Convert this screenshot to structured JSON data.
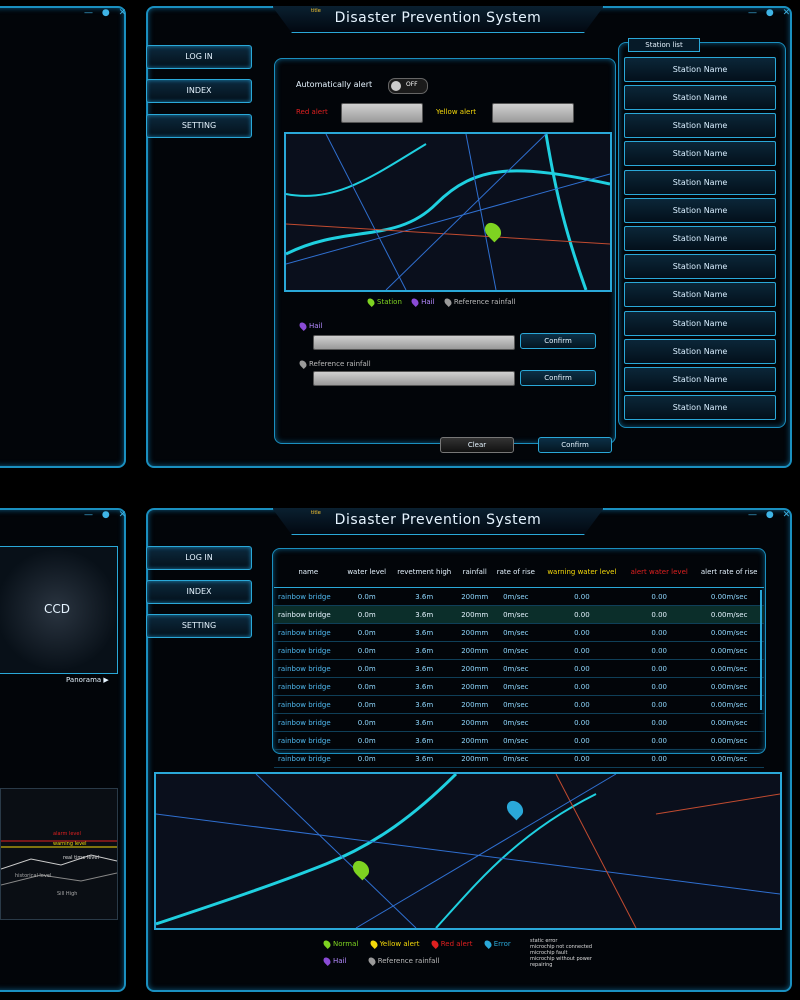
{
  "top": {
    "title_small": "title",
    "title": "Disaster Prevention System",
    "nav": [
      "LOG IN",
      "INDEX",
      "SETTING"
    ],
    "auto_alert": {
      "label": "Automatically alert",
      "toggle": "OFF"
    },
    "red_alert_label": "Red alert",
    "yellow_alert_label": "Yellow alert",
    "red_alert_value": "",
    "yellow_alert_value": "",
    "map_legend": {
      "station": "Station",
      "hail": "Hail",
      "reference": "Reference rainfall"
    },
    "hail_label": "Hail",
    "reference_label": "Reference rainfall",
    "confirm": "Confirm",
    "clear": "Clear",
    "station_list_title": "Station list",
    "stations": [
      "Station Name",
      "Station Name",
      "Station Name",
      "Station Name",
      "Station Name",
      "Station Name",
      "Station Name",
      "Station Name",
      "Station Name",
      "Station Name",
      "Station Name",
      "Station Name",
      "Station Name"
    ]
  },
  "bottom": {
    "title_small": "title",
    "title": "Disaster Prevention System",
    "nav": [
      "LOG IN",
      "INDEX",
      "SETTING"
    ],
    "ccd_label": "CCD",
    "panorama": "Panorama ▶",
    "chart_levels": [
      "alarm level",
      "warning level",
      "real time level",
      "historical level",
      "Sill High"
    ],
    "table": {
      "headers": [
        "name",
        "water level",
        "revetment high",
        "rainfall",
        "rate of rise",
        "warning water level",
        "alert water level",
        "alert rate of rise"
      ],
      "rows": [
        [
          "rainbow bridge",
          "0.0m",
          "3.6m",
          "200mm",
          "0m/sec",
          "0.00",
          "0.00",
          "0.00m/sec"
        ],
        [
          "rainbow bridge",
          "0.0m",
          "3.6m",
          "200mm",
          "0m/sec",
          "0.00",
          "0.00",
          "0.00m/sec"
        ],
        [
          "rainbow bridge",
          "0.0m",
          "3.6m",
          "200mm",
          "0m/sec",
          "0.00",
          "0.00",
          "0.00m/sec"
        ],
        [
          "rainbow bridge",
          "0.0m",
          "3.6m",
          "200mm",
          "0m/sec",
          "0.00",
          "0.00",
          "0.00m/sec"
        ],
        [
          "rainbow bridge",
          "0.0m",
          "3.6m",
          "200mm",
          "0m/sec",
          "0.00",
          "0.00",
          "0.00m/sec"
        ],
        [
          "rainbow bridge",
          "0.0m",
          "3.6m",
          "200mm",
          "0m/sec",
          "0.00",
          "0.00",
          "0.00m/sec"
        ],
        [
          "rainbow bridge",
          "0.0m",
          "3.6m",
          "200mm",
          "0m/sec",
          "0.00",
          "0.00",
          "0.00m/sec"
        ],
        [
          "rainbow bridge",
          "0.0m",
          "3.6m",
          "200mm",
          "0m/sec",
          "0.00",
          "0.00",
          "0.00m/sec"
        ],
        [
          "rainbow bridge",
          "0.0m",
          "3.6m",
          "200mm",
          "0m/sec",
          "0.00",
          "0.00",
          "0.00m/sec"
        ],
        [
          "rainbow bridge",
          "0.0m",
          "3.6m",
          "200mm",
          "0m/sec",
          "0.00",
          "0.00",
          "0.00m/sec"
        ],
        [
          "rainbow bridge",
          "0.0m",
          "3.6m",
          "200mm",
          "0m/sec",
          "0.00",
          "0.00",
          "0.00m/sec"
        ],
        [
          "rainbow bridge",
          "0.0m",
          "3.6m",
          "200mm",
          "0m/sec",
          "0.00",
          "0.00",
          "0.00m/sec"
        ]
      ]
    },
    "legend": {
      "normal": "Normal",
      "yellow": "Yellow alert",
      "red": "Red alert",
      "error": "Error",
      "hail": "Hail",
      "reference": "Reference rainfall",
      "status_notes": [
        "static error",
        "microchip not connected",
        "microchip fault",
        "microchip without power",
        "repairing"
      ]
    }
  },
  "colors": {
    "accent": "#2aa8d8",
    "normal": "#7ed321",
    "yellow": "#f5d90a",
    "red": "#e02020",
    "error": "#2aa8d8",
    "hail": "#8a4bd6",
    "reference": "#9a9a9a"
  }
}
